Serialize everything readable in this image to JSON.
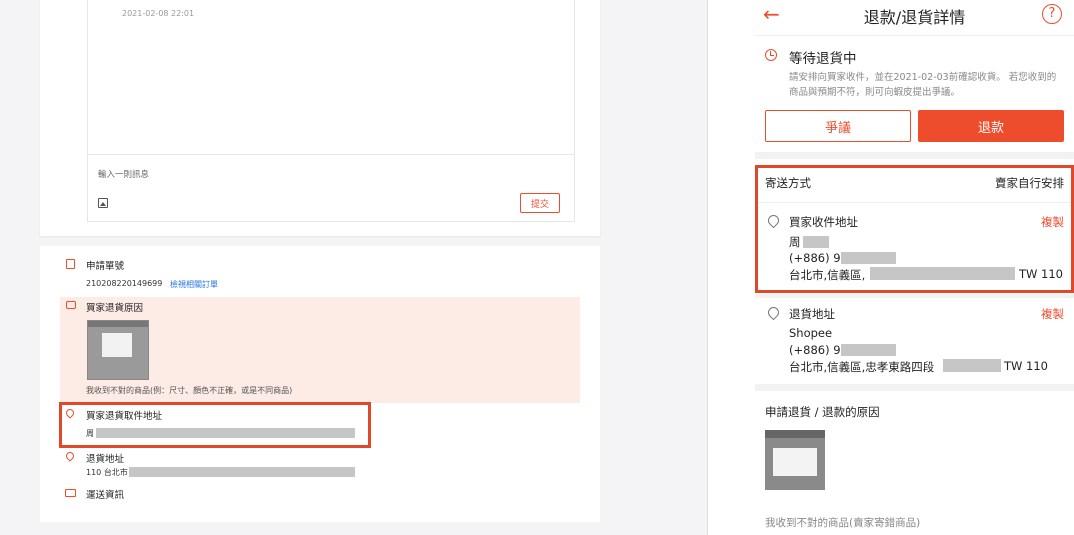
{
  "left": {
    "chat": {
      "timestamp": "2021-02-08 22:01",
      "input_placeholder": "輸入一則訊息",
      "submit_label": "提交"
    },
    "application": {
      "label": "申請單號",
      "number": "210208220149699",
      "view_order_link": "檢視相關訂單"
    },
    "return_reason": {
      "label": "買家退貨原因",
      "text": "我收到不對的商品(例：尺寸、顏色不正確，或是不同商品)"
    },
    "pickup_address": {
      "label": "買家退貨取件地址",
      "name": "周"
    },
    "return_address": {
      "label": "退貨地址",
      "postal_city": "110 台北市"
    },
    "shipping": {
      "label": "運送資訊"
    }
  },
  "right": {
    "header": {
      "back_icon": "←",
      "title": "退款/退貨詳情",
      "help_icon": "?"
    },
    "status": {
      "title": "等待退貨中",
      "desc": "請安排向買家收件，並在2021-02-03前確認收貨。 若您收到的商品與預期不符，則可向蝦皮提出爭議。"
    },
    "buttons": {
      "dispute": "爭議",
      "refund": "退款"
    },
    "shipping_method": {
      "label": "寄送方式",
      "value": "賣家自行安排"
    },
    "buyer_address": {
      "label": "買家收件地址",
      "copy": "複製",
      "name": "周",
      "phone": "(+886) 9",
      "addr_prefix": "台北市,信義區,",
      "zip": "TW 110"
    },
    "return_address": {
      "label": "退貨地址",
      "copy": "複製",
      "name": "Shopee",
      "phone": "(+886) 9",
      "addr_prefix": "台北市,信義區,忠孝東路四段",
      "zip": "TW 110"
    },
    "reason": {
      "label": "申請退貨 / 退款的原因",
      "text": "我收到不對的商品(賣家寄錯商品)"
    }
  },
  "colors": {
    "accent": "#ee4d2d",
    "highlight_border": "#e0482a",
    "pink_bg": "#fdebe6"
  }
}
